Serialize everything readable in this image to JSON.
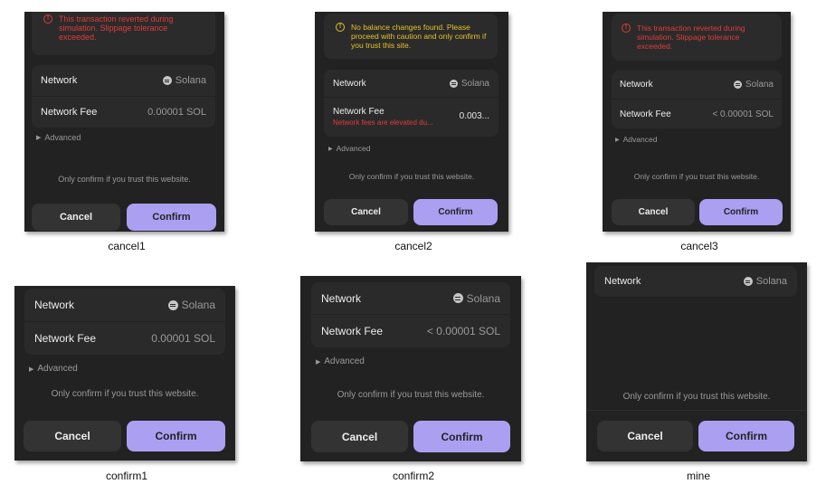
{
  "screens": {
    "cancel1": {
      "caption": "cancel1",
      "warning": "This transaction reverted during simulation. Slippage tolerance exceeded.",
      "network_label": "Network",
      "network_value": "Solana",
      "fee_label": "Network Fee",
      "fee_value": "0.00001 SOL",
      "advanced": "Advanced",
      "trust": "Only confirm if you trust this website.",
      "cancel": "Cancel",
      "confirm": "Confirm"
    },
    "cancel2": {
      "caption": "cancel2",
      "warning": "No balance changes found. Please proceed with caution and only confirm if you trust this site.",
      "network_label": "Network",
      "network_value": "Solana",
      "fee_label": "Network Fee",
      "fee_value": "0.003...",
      "fee_sub": "Network fees are elevated du...",
      "advanced": "Advanced",
      "trust": "Only confirm if you trust this website.",
      "cancel": "Cancel",
      "confirm": "Confirm"
    },
    "cancel3": {
      "caption": "cancel3",
      "warning": "This transaction reverted during simulation. Slippage tolerance exceeded.",
      "network_label": "Network",
      "network_value": "Solana",
      "fee_label": "Network Fee",
      "fee_value": "< 0.00001 SOL",
      "advanced": "Advanced",
      "trust": "Only confirm if you trust this website.",
      "cancel": "Cancel",
      "confirm": "Confirm"
    },
    "confirm1": {
      "caption": "confirm1",
      "network_label": "Network",
      "network_value": "Solana",
      "fee_label": "Network Fee",
      "fee_value": "0.00001 SOL",
      "advanced": "Advanced",
      "trust": "Only confirm if you trust this website.",
      "cancel": "Cancel",
      "confirm": "Confirm"
    },
    "confirm2": {
      "caption": "confirm2",
      "network_label": "Network",
      "network_value": "Solana",
      "fee_label": "Network Fee",
      "fee_value": "< 0.00001 SOL",
      "advanced": "Advanced",
      "trust": "Only confirm if you trust this website.",
      "cancel": "Cancel",
      "confirm": "Confirm"
    },
    "mine": {
      "caption": "mine",
      "network_label": "Network",
      "network_value": "Solana",
      "trust": "Only confirm if you trust this website.",
      "cancel": "Cancel",
      "confirm": "Confirm"
    }
  },
  "icons": {
    "warning": "warning-circle-icon",
    "network": "solana-icon",
    "advanced": "triangle-right-icon"
  },
  "colors": {
    "panel_bg": "#222222",
    "card_bg": "#2a2a2a",
    "confirm_accent": "#ab9ff2",
    "error_red": "#e03b3b",
    "caution_yellow": "#e6c229"
  }
}
